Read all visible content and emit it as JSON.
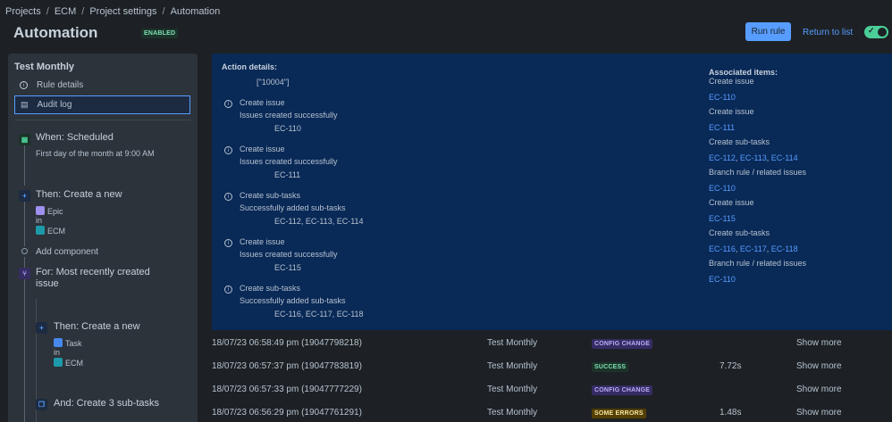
{
  "breadcrumb": [
    "Projects",
    "ECM",
    "Project settings",
    "Automation"
  ],
  "page": {
    "title": "Automation",
    "status": "ENABLED"
  },
  "header": {
    "run_rule": "Run rule",
    "return": "Return to list"
  },
  "sidebar": {
    "title": "Test Monthly",
    "items": [
      {
        "label": "Rule details",
        "icon": "info-icon"
      },
      {
        "label": "Audit log",
        "icon": "document-icon"
      }
    ],
    "trigger": {
      "title": "When: Scheduled",
      "detail": "First day of the month at 9:00 AM"
    },
    "action1": {
      "title": "Then: Create a new",
      "type": "Epic",
      "in": "in",
      "project": "ECM"
    },
    "add_component": "Add component",
    "branch": {
      "title": "For: Most recently created issue"
    },
    "action2": {
      "title": "Then: Create a new",
      "type": "Task",
      "in": "in",
      "project": "ECM"
    },
    "action3": {
      "title": "And: Create 3 sub-tasks"
    }
  },
  "details": {
    "action_label": "Action details:",
    "action_value": "[\"10004\"]",
    "entries": [
      {
        "title": "Create issue",
        "subtitle": "Issues created successfully",
        "value": "EC-110"
      },
      {
        "title": "Create issue",
        "subtitle": "Issues created successfully",
        "value": "EC-111"
      },
      {
        "title": "Create sub-tasks",
        "subtitle": "Successfully added sub-tasks",
        "value": "EC-112, EC-113, EC-114"
      },
      {
        "title": "Create issue",
        "subtitle": "Issues created successfully",
        "value": "EC-115"
      },
      {
        "title": "Create sub-tasks",
        "subtitle": "Successfully added sub-tasks",
        "value": "EC-116, EC-117, EC-118"
      }
    ],
    "assoc_label": "Associated items:",
    "assoc": [
      {
        "label": "Create issue",
        "links": [
          "EC-110"
        ]
      },
      {
        "label": "Create issue",
        "links": [
          "EC-111"
        ]
      },
      {
        "label": "Create sub-tasks",
        "links": [
          "EC-112",
          "EC-113",
          "EC-114"
        ]
      },
      {
        "label": "Branch rule / related issues",
        "links": [
          "EC-110"
        ]
      },
      {
        "label": "Create issue",
        "links": [
          "EC-115"
        ]
      },
      {
        "label": "Create sub-tasks",
        "links": [
          "EC-116",
          "EC-117",
          "EC-118"
        ]
      },
      {
        "label": "Branch rule / related issues",
        "links": [
          "EC-110"
        ]
      }
    ]
  },
  "log": [
    {
      "time": "18/07/23 06:58:49 pm (19047798218)",
      "rule": "Test Monthly",
      "status": "CONFIG CHANGE",
      "status_kind": "config",
      "duration": "",
      "more": "Show more"
    },
    {
      "time": "18/07/23 06:57:37 pm (19047783819)",
      "rule": "Test Monthly",
      "status": "SUCCESS",
      "status_kind": "success",
      "duration": "7.72s",
      "more": "Show more"
    },
    {
      "time": "18/07/23 06:57:33 pm (19047777229)",
      "rule": "Test Monthly",
      "status": "CONFIG CHANGE",
      "status_kind": "config",
      "duration": "",
      "more": "Show more"
    },
    {
      "time": "18/07/23 06:56:29 pm (19047761291)",
      "rule": "Test Monthly",
      "status": "SOME ERRORS",
      "status_kind": "errors",
      "duration": "1.48s",
      "more": "Show more"
    }
  ]
}
